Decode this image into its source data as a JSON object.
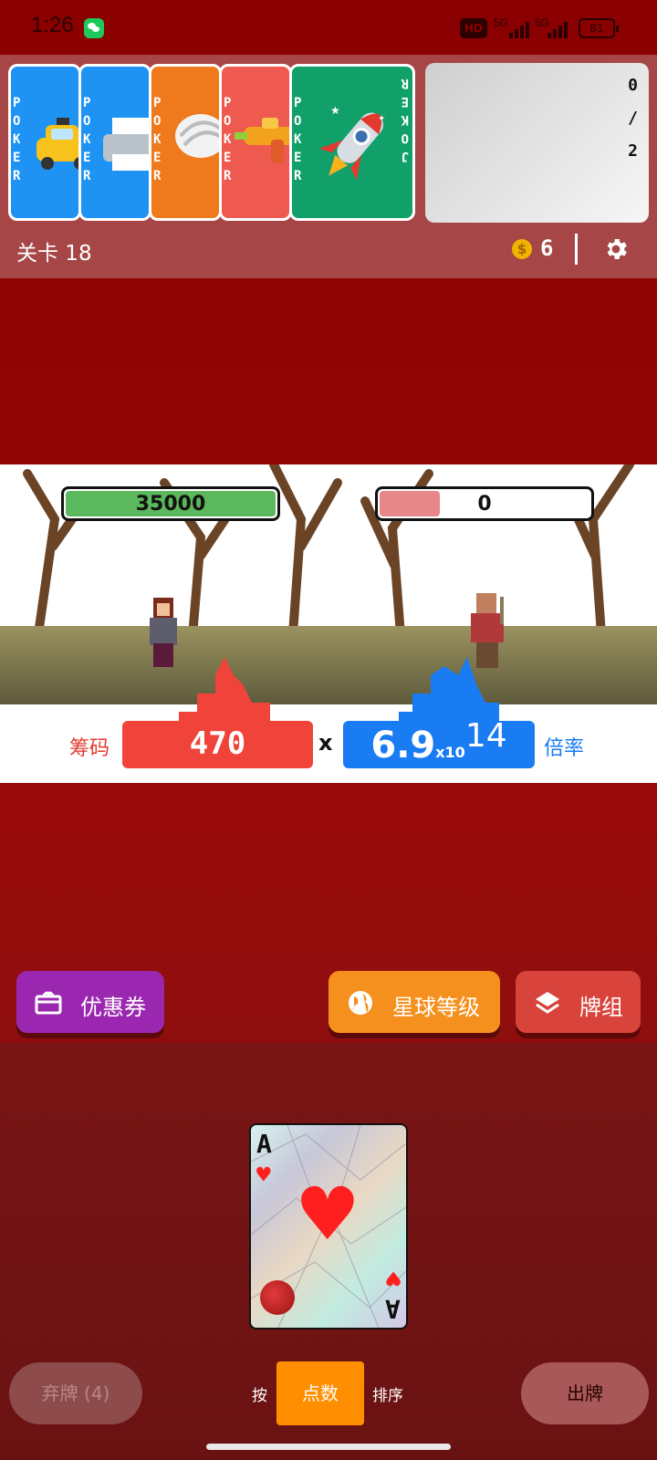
{
  "status_bar": {
    "time": "1:26",
    "hd": "HD",
    "signal1": "5G",
    "signal2": "5G",
    "battery": "81"
  },
  "jokers": [
    {
      "text": "POKER",
      "color": "#1e93f3",
      "icon": "taxi-icon"
    },
    {
      "text": "POKER",
      "color": "#1e93f3",
      "icon": "printer-icon"
    },
    {
      "text": "POKER",
      "color": "#ee7a1d",
      "icon": "seashell-icon"
    },
    {
      "text": "POKER",
      "color": "#ef5a50",
      "icon": "water-gun-icon"
    },
    {
      "text": "POKER",
      "color": "#12a06a",
      "icon": "rocket-icon",
      "side_text": "JOKER"
    }
  ],
  "joker_slots": {
    "top": "0",
    "sep": "/",
    "bottom": "2"
  },
  "level": "关卡 18",
  "coins": "6",
  "battle": {
    "player_hp": "35000",
    "player_hp_fraction": 1.0,
    "enemy_hp": "0",
    "enemy_hp_fraction": 0.3,
    "chips_label": "筹码",
    "chips_value": "470",
    "times": "x",
    "mult_base": "6.9",
    "mult_x": "x10",
    "mult_exp": "14",
    "mult_label": "倍率"
  },
  "actions": {
    "coupon": "优惠券",
    "planet_level": "星球等级",
    "deck": "牌组"
  },
  "hand_card": {
    "rank": "A",
    "suit": "hearts",
    "suit_glyph": "♥"
  },
  "bottom": {
    "discard": "弃牌 (4)",
    "sort_prefix": "按",
    "sort_key": "点数",
    "sort_suffix": "排序",
    "play": "出牌"
  },
  "colors": {
    "accent_red": "#f0433a",
    "accent_blue": "#1a7cf2",
    "hp_green": "#5cb85c",
    "hp_pink": "#e8878a"
  }
}
